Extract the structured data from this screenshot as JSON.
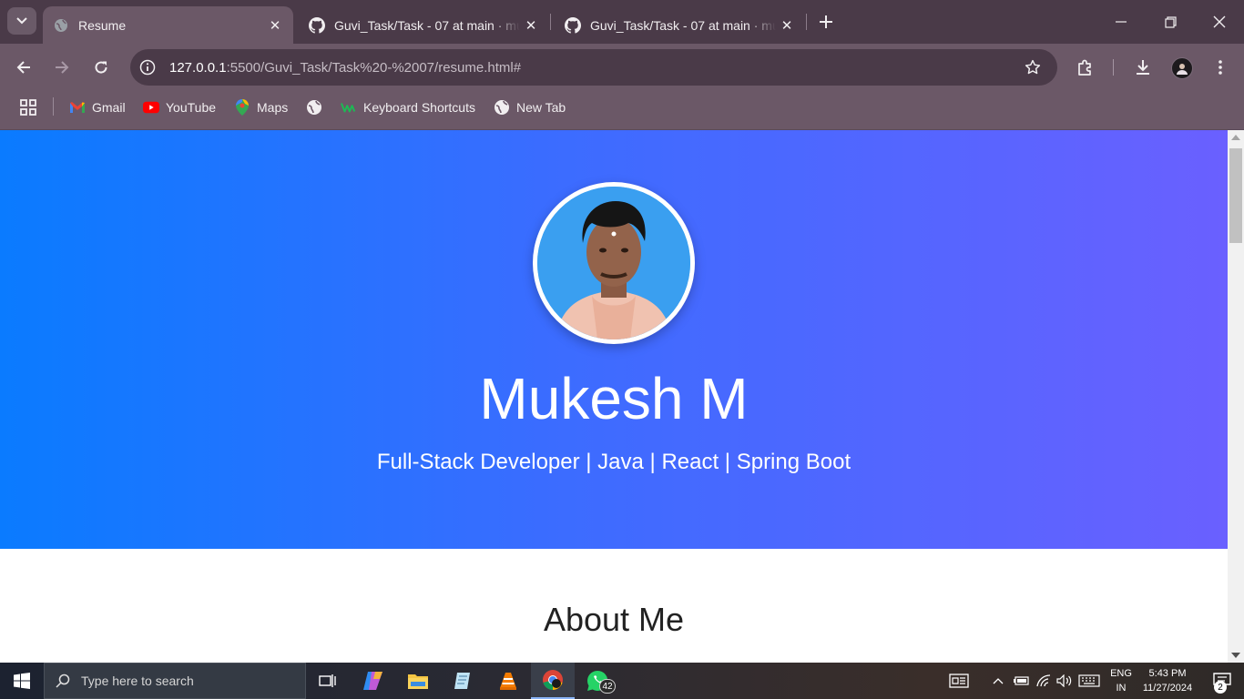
{
  "browser": {
    "tabs": [
      {
        "title": "Resume",
        "active": true,
        "favicon": "globe-icon"
      },
      {
        "title": "Guvi_Task/Task - 07 at main · mukesh",
        "active": false,
        "favicon": "github-icon"
      },
      {
        "title": "Guvi_Task/Task - 07 at main · mukesh",
        "active": false,
        "favicon": "github-icon"
      }
    ],
    "url": {
      "host": "127.0.0.1",
      "rest": ":5500/Guvi_Task/Task%20-%2007/resume.html#"
    },
    "bookmarks": [
      {
        "label": "Gmail",
        "icon": "gmail-icon"
      },
      {
        "label": "YouTube",
        "icon": "youtube-icon"
      },
      {
        "label": "Maps",
        "icon": "maps-icon"
      },
      {
        "label": "",
        "icon": "globe-icon"
      },
      {
        "label": "Keyboard Shortcuts",
        "icon": "keyboard-shortcuts-icon"
      },
      {
        "label": "New Tab",
        "icon": "globe-icon"
      }
    ]
  },
  "page": {
    "name": "Mukesh M",
    "tagline": "Full-Stack Developer | Java | React | Spring Boot",
    "about_heading": "About Me"
  },
  "taskbar": {
    "search_placeholder": "Type here to search",
    "whatsapp_badge": "42",
    "language": {
      "line1": "ENG",
      "line2": "IN"
    },
    "clock": {
      "time": "5:43 PM",
      "date": "11/27/2024"
    },
    "notifications": "2"
  },
  "colors": {
    "hero_gradient_start": "#0a7bff",
    "hero_gradient_end": "#6a60ff",
    "chrome_frame": "#4a3a48",
    "chrome_toolbar": "#6b5867"
  }
}
